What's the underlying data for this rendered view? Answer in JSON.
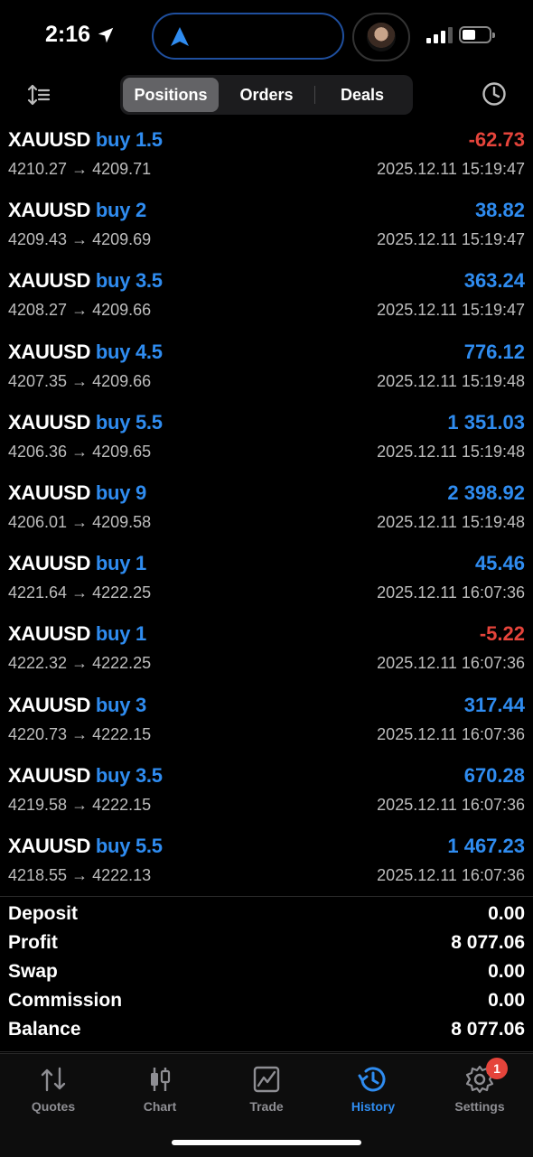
{
  "status": {
    "time": "2:16"
  },
  "toolbar": {
    "tabs": [
      {
        "label": "Positions",
        "active": true
      },
      {
        "label": "Orders",
        "active": false
      },
      {
        "label": "Deals",
        "active": false
      }
    ]
  },
  "deals": [
    {
      "symbol": "XAUUSD",
      "side": "buy 1.5",
      "profit": "-62.73",
      "negative": true,
      "prices": "4210.27 → 4209.71",
      "time": "2025.12.11 15:19:47"
    },
    {
      "symbol": "XAUUSD",
      "side": "buy 2",
      "profit": "38.82",
      "negative": false,
      "prices": "4209.43 → 4209.69",
      "time": "2025.12.11 15:19:47"
    },
    {
      "symbol": "XAUUSD",
      "side": "buy 3.5",
      "profit": "363.24",
      "negative": false,
      "prices": "4208.27 → 4209.66",
      "time": "2025.12.11 15:19:47"
    },
    {
      "symbol": "XAUUSD",
      "side": "buy 4.5",
      "profit": "776.12",
      "negative": false,
      "prices": "4207.35 → 4209.66",
      "time": "2025.12.11 15:19:48"
    },
    {
      "symbol": "XAUUSD",
      "side": "buy 5.5",
      "profit": "1 351.03",
      "negative": false,
      "prices": "4206.36 → 4209.65",
      "time": "2025.12.11 15:19:48"
    },
    {
      "symbol": "XAUUSD",
      "side": "buy 9",
      "profit": "2 398.92",
      "negative": false,
      "prices": "4206.01 → 4209.58",
      "time": "2025.12.11 15:19:48"
    },
    {
      "symbol": "XAUUSD",
      "side": "buy 1",
      "profit": "45.46",
      "negative": false,
      "prices": "4221.64 → 4222.25",
      "time": "2025.12.11 16:07:36"
    },
    {
      "symbol": "XAUUSD",
      "side": "buy 1",
      "profit": "-5.22",
      "negative": true,
      "prices": "4222.32 → 4222.25",
      "time": "2025.12.11 16:07:36"
    },
    {
      "symbol": "XAUUSD",
      "side": "buy 3",
      "profit": "317.44",
      "negative": false,
      "prices": "4220.73 → 4222.15",
      "time": "2025.12.11 16:07:36"
    },
    {
      "symbol": "XAUUSD",
      "side": "buy 3.5",
      "profit": "670.28",
      "negative": false,
      "prices": "4219.58 → 4222.15",
      "time": "2025.12.11 16:07:36"
    },
    {
      "symbol": "XAUUSD",
      "side": "buy 5.5",
      "profit": "1 467.23",
      "negative": false,
      "prices": "4218.55 → 4222.13",
      "time": "2025.12.11 16:07:36"
    }
  ],
  "summary": [
    {
      "label": "Deposit",
      "value": "0.00"
    },
    {
      "label": "Profit",
      "value": "8 077.06"
    },
    {
      "label": "Swap",
      "value": "0.00"
    },
    {
      "label": "Commission",
      "value": "0.00"
    },
    {
      "label": "Balance",
      "value": "8 077.06"
    }
  ],
  "tabbar": {
    "items": [
      {
        "label": "Quotes",
        "icon": "quotes-icon"
      },
      {
        "label": "Chart",
        "icon": "chart-icon"
      },
      {
        "label": "Trade",
        "icon": "trade-icon"
      },
      {
        "label": "History",
        "icon": "history-icon",
        "active": true
      },
      {
        "label": "Settings",
        "icon": "settings-icon",
        "badge": "1"
      }
    ]
  },
  "colors": {
    "accent": "#2f8cf0",
    "negative": "#e5443b",
    "background": "#000000"
  }
}
